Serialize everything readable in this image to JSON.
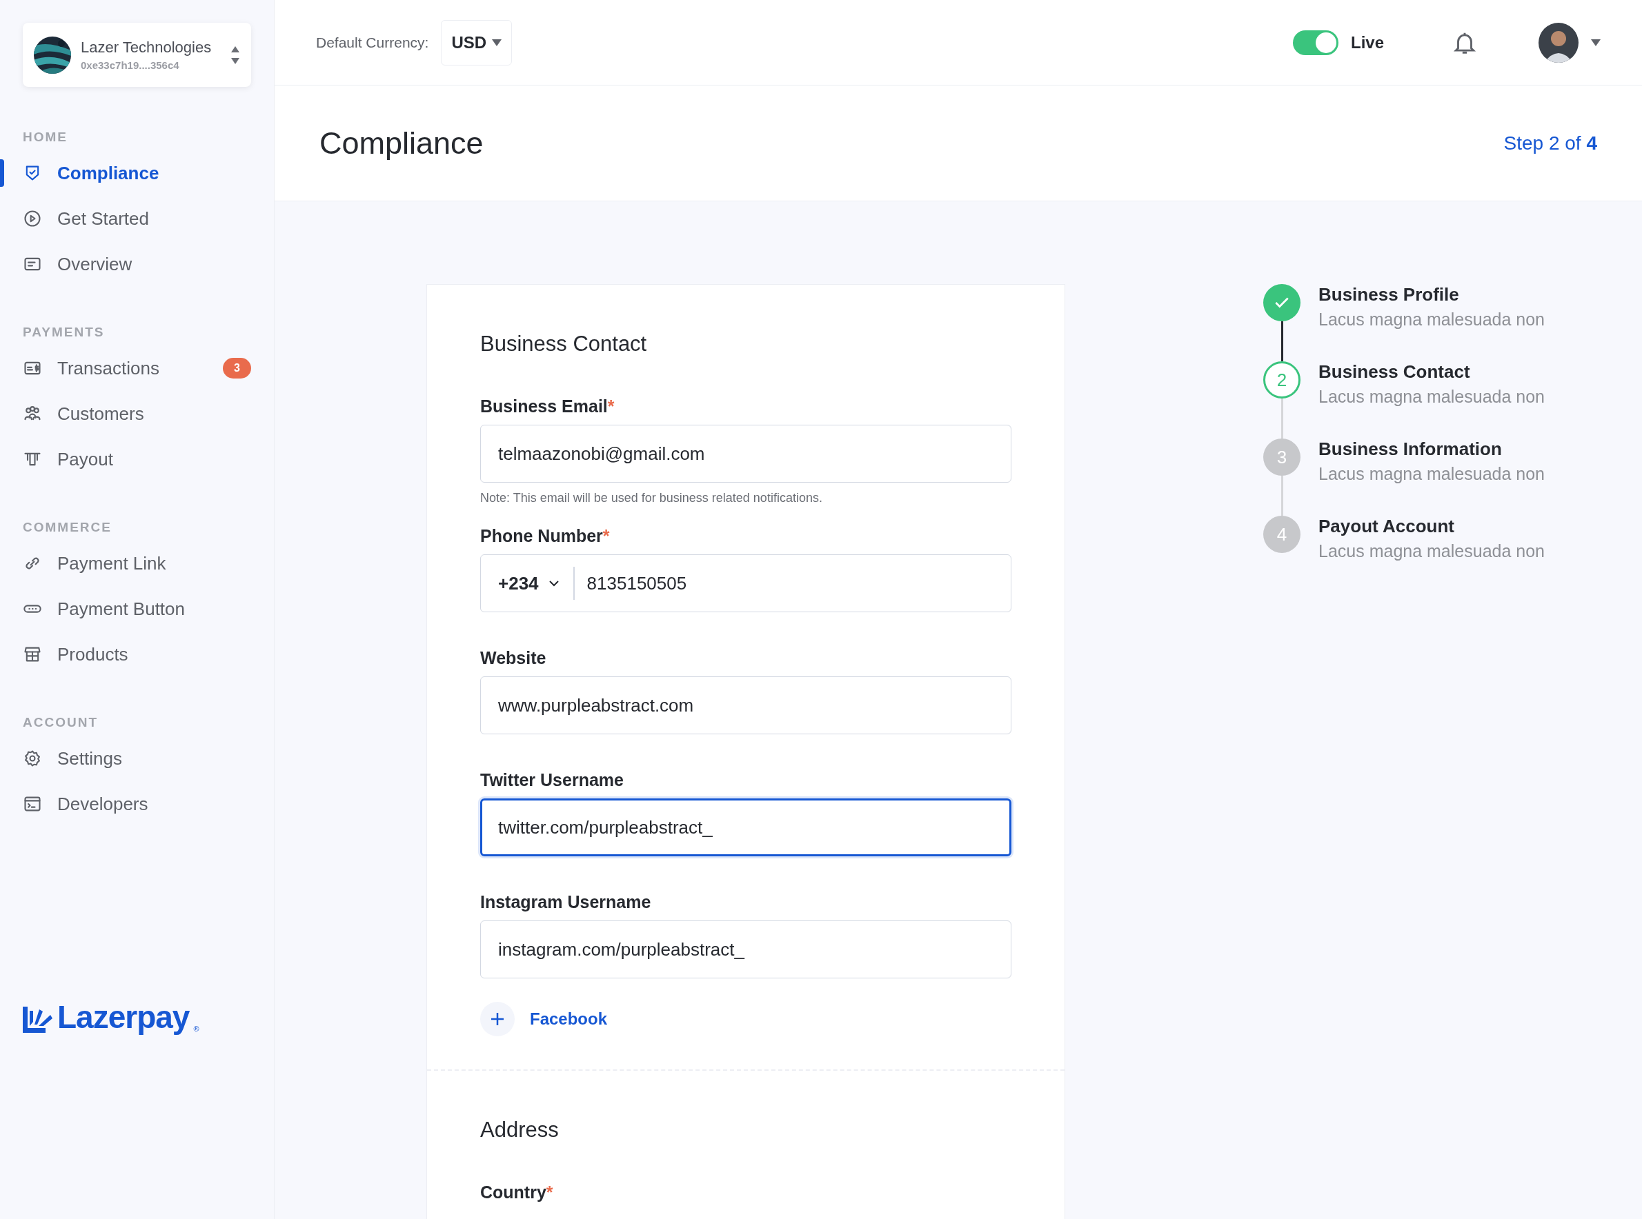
{
  "org": {
    "name": "Lazer Technologies",
    "address": "0xe33c7h19....356c4"
  },
  "sidebar": {
    "sections": [
      {
        "label": "HOME",
        "items": [
          {
            "label": "Compliance",
            "selected": true
          },
          {
            "label": "Get Started",
            "selected": false
          },
          {
            "label": "Overview",
            "selected": false
          }
        ]
      },
      {
        "label": "PAYMENTS",
        "items": [
          {
            "label": "Transactions",
            "selected": false,
            "badge": "3",
            "color": "#e96b4c"
          },
          {
            "label": "Customers",
            "selected": false
          },
          {
            "label": "Payout",
            "selected": false
          }
        ]
      },
      {
        "label": "COMMERCE",
        "items": [
          {
            "label": "Payment Link",
            "selected": false
          },
          {
            "label": "Payment Button",
            "selected": false
          },
          {
            "label": "Products",
            "selected": false
          }
        ]
      },
      {
        "label": "ACCOUNT",
        "items": [
          {
            "label": "Settings",
            "selected": false
          },
          {
            "label": "Developers",
            "selected": false
          }
        ]
      }
    ],
    "logo": {
      "name": "Lazerpay",
      "mark": "®"
    }
  },
  "header": {
    "currency_label": "Default Currency:",
    "currency": "USD",
    "mode": {
      "label": "Live",
      "on": true
    }
  },
  "page": {
    "title": "Compliance",
    "step": "Step 2 of **4**"
  },
  "form": {
    "sections": [
      {
        "title": "Business Contact",
        "fields": [
          {
            "kind": "text",
            "label": "Business Email",
            "required_mark": "*",
            "value": "telmaazonobi@gmail.com",
            "focused": false,
            "note": "Note: This email will be used for business related notifications."
          },
          {
            "kind": "phone",
            "label": "Phone Number",
            "required_mark": "*",
            "code": "+234",
            "value": "8135150505",
            "focused": false
          },
          {
            "kind": "text",
            "label": "Website",
            "value": "www.purpleabstract.com",
            "focused": false
          },
          {
            "kind": "text",
            "label": "Twitter Username",
            "value": "twitter.com/purpleabstract_",
            "focused": true
          },
          {
            "kind": "text",
            "label": "Instagram Username",
            "value": "instagram.com/purpleabstract_",
            "focused": false
          }
        ],
        "add_link": "Facebook"
      },
      {
        "title": "Address",
        "fields": [
          {
            "kind": "label",
            "label": "Country",
            "required_mark": "*"
          }
        ]
      }
    ]
  },
  "steps": [
    {
      "title": "Business Profile",
      "subtitle": "Lacus magna malesuada non",
      "completed": true,
      "selected": false
    },
    {
      "title": "Business Contact",
      "subtitle": "Lacus magna malesuada non",
      "completed": false,
      "selected": true,
      "number": "2"
    },
    {
      "title": "Business Information",
      "subtitle": "Lacus magna malesuada non",
      "completed": false,
      "selected": false,
      "number": "3"
    },
    {
      "title": "Payout Account",
      "subtitle": "Lacus magna malesuada non",
      "completed": false,
      "selected": false,
      "number": "4"
    }
  ]
}
